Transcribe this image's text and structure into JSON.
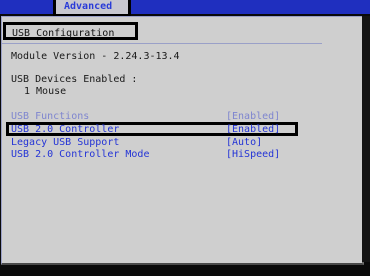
{
  "top_tab": {
    "label": "Advanced"
  },
  "section": {
    "title": "USB Configuration"
  },
  "info": {
    "module_version": "Module Version - 2.24.3-13.4",
    "devices_header": "USB Devices Enabled :",
    "devices_value": "1 Mouse"
  },
  "options": [
    {
      "label": "USB Functions",
      "value": "[Enabled]"
    },
    {
      "label": "USB 2.0 Controller",
      "value": "[Enabled]"
    },
    {
      "label": "Legacy USB Support",
      "value": "[Auto]"
    },
    {
      "label": "USB 2.0 Controller Mode",
      "value": "[HiSpeed]"
    }
  ],
  "colors": {
    "menu_bar": "#1f2fbf",
    "panel_bg": "#cfcfcf",
    "option_text": "#2434d6"
  }
}
